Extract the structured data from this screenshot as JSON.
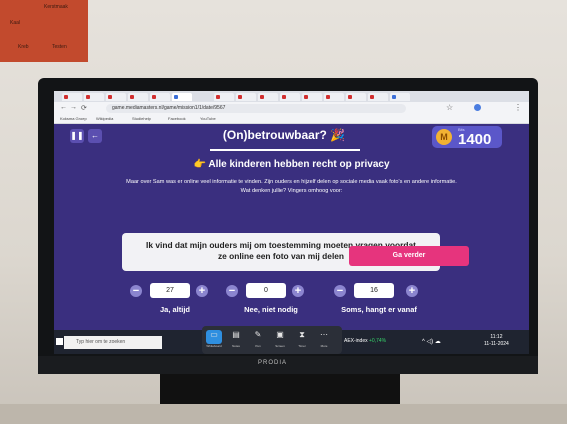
{
  "poster": {
    "cells": [
      "Kerstmaak",
      "Kaal",
      "Kreb",
      "Testen"
    ]
  },
  "browser": {
    "url": "game.mediamasters.nl/game/mission1/1/date/9567",
    "bookmarks": [
      "Koksma Groep",
      "Wikipedia",
      "Studiehelp",
      "Facebook",
      "YouTube"
    ]
  },
  "app": {
    "title": "(On)betrouwbaar? 🎉",
    "bits_label": "Bits",
    "bits_value": "1400",
    "subtitle": "👉 Alle kinderen hebben recht op privacy",
    "intro_line1": "Maar over Sam was er online veel informatie te vinden. Zijn ouders en hijzelf delen op sociale media vaak foto's en andere informatie.",
    "intro_line2": "Wat denken jullie? Vingers omhoog voor:",
    "question_line1": "Ik vind dat mijn ouders mij om toestemming moeten vragen voordat",
    "question_line2": "ze online een foto van mij delen",
    "steppers": [
      {
        "value": "27",
        "label": "Ja, altijd"
      },
      {
        "value": "0",
        "label": "Nee, niet nodig"
      },
      {
        "value": "16",
        "label": "Soms, hangt er vanaf"
      }
    ],
    "next_button": "Ga verder"
  },
  "taskbar": {
    "search_placeholder": "Typ hier om te zoeken",
    "pinned": [
      "Whiteboard",
      "Notes",
      "Pen",
      "Screen",
      "Timer",
      "More"
    ],
    "stock_name": "AEX-index",
    "stock_change": "+0,74%",
    "time": "11:12",
    "date": "11-11-2024"
  },
  "brand": "PRODIA",
  "colors": {
    "app_bg": "#3a2f7f",
    "accent_pink": "#e6347d",
    "coin": "#f2b233"
  }
}
